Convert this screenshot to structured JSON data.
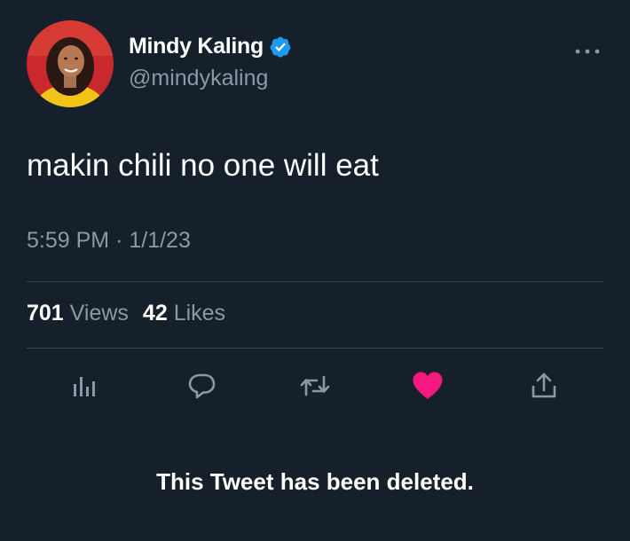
{
  "user": {
    "display_name": "Mindy Kaling",
    "handle": "@mindykaling",
    "verified": true
  },
  "tweet": {
    "text": "makin chili no one will eat",
    "time": "5:59 PM",
    "separator": "·",
    "date": "1/1/23"
  },
  "stats": {
    "views_count": "701",
    "views_label": "Views",
    "likes_count": "42",
    "likes_label": "Likes"
  },
  "actions": {
    "icons": [
      "analytics-icon",
      "reply-icon",
      "retweet-icon",
      "like-icon",
      "share-icon"
    ],
    "liked": true
  },
  "notice": {
    "deleted_text": "This Tweet has been deleted."
  },
  "colors": {
    "background": "#15202b",
    "secondary_text": "#8b98a5",
    "divider": "#38444d",
    "verified_blue": "#1d9bf0",
    "like_pink": "#f91880"
  }
}
